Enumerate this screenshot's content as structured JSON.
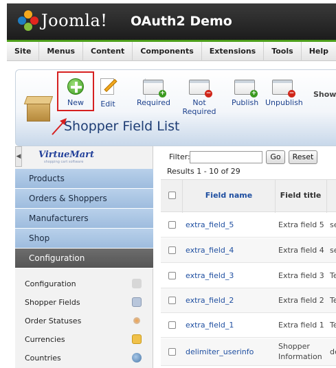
{
  "header": {
    "logo_text": "Joomla!",
    "site_title": "OAuth2 Demo"
  },
  "menu": [
    "Site",
    "Menus",
    "Content",
    "Components",
    "Extensions",
    "Tools",
    "Help"
  ],
  "toolbar": {
    "new_label": "New",
    "edit_label": "Edit",
    "required_label": "Required",
    "not_required_label": "Not Required",
    "publish_label": "Publish",
    "unpublish_label": "Unpublish",
    "showhide_label": "Show/"
  },
  "page_title": "Shopper Field List",
  "sidebar": {
    "logo_text": "VirtueMart",
    "logo_tagline": "shopping cart software",
    "categories": [
      "Products",
      "Orders & Shoppers",
      "Manufacturers",
      "Shop",
      "Configuration"
    ],
    "active_category": "Configuration",
    "sub_items": [
      {
        "label": "Configuration",
        "icon": "tools-icon"
      },
      {
        "label": "Shopper Fields",
        "icon": "fields-icon"
      },
      {
        "label": "Order Statuses",
        "icon": "status-icon"
      },
      {
        "label": "Currencies",
        "icon": "coins-icon"
      },
      {
        "label": "Countries",
        "icon": "globe-icon"
      }
    ]
  },
  "main": {
    "filter_label": "Filter:",
    "filter_value": "",
    "go_label": "Go",
    "reset_label": "Reset",
    "results_text": "Results 1 - 10 of 29",
    "columns": {
      "name": "Field name",
      "title": "Field title"
    },
    "rows": [
      {
        "name": "extra_field_5",
        "title": "Extra field 5",
        "extra": "se"
      },
      {
        "name": "extra_field_4",
        "title": "Extra field 4",
        "extra": "se"
      },
      {
        "name": "extra_field_3",
        "title": "Extra field 3",
        "extra": "Te"
      },
      {
        "name": "extra_field_2",
        "title": "Extra field 2",
        "extra": "Te"
      },
      {
        "name": "extra_field_1",
        "title": "Extra field 1",
        "extra": "Te"
      },
      {
        "name": "delimiter_userinfo",
        "title_line1": "Shopper",
        "title_line2": "Information",
        "extra": "de"
      }
    ]
  }
}
